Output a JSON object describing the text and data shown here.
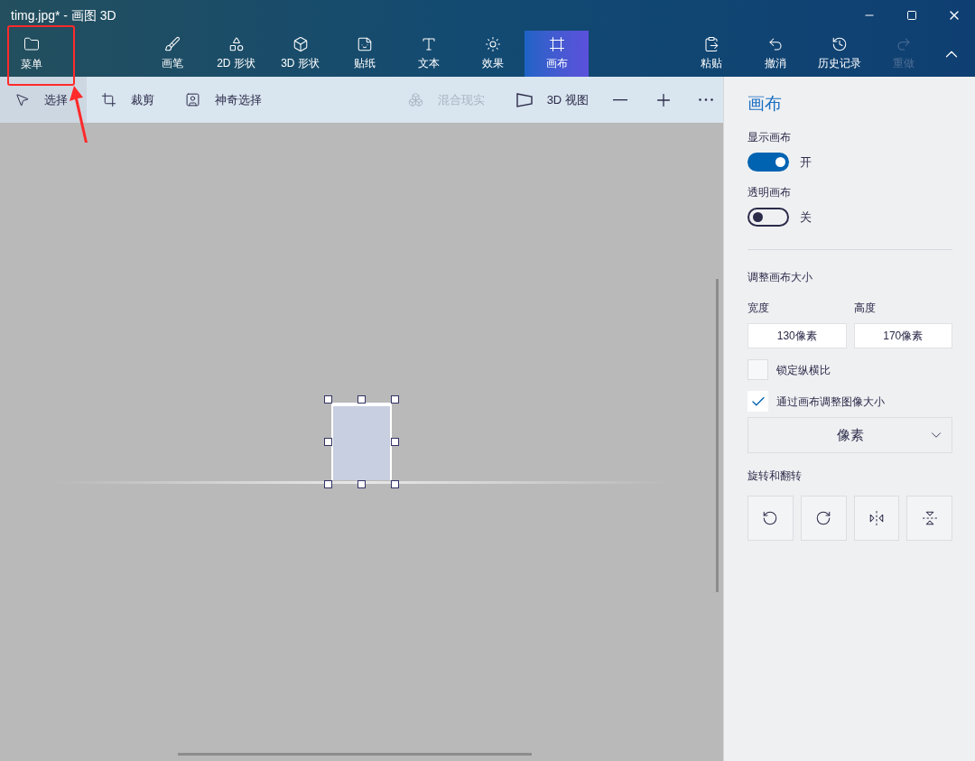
{
  "window": {
    "title": "timg.jpg* - 画图 3D"
  },
  "menu_button": {
    "label": "菜单"
  },
  "tools": [
    {
      "label": "画笔",
      "selected": false
    },
    {
      "label": "2D 形状",
      "selected": false
    },
    {
      "label": "3D 形状",
      "selected": false
    },
    {
      "label": "贴纸",
      "selected": false
    },
    {
      "label": "文本",
      "selected": false
    },
    {
      "label": "效果",
      "selected": false
    },
    {
      "label": "画布",
      "selected": true
    }
  ],
  "actions": [
    {
      "label": "粘贴",
      "disabled": false
    },
    {
      "label": "撤消",
      "disabled": false
    },
    {
      "label": "历史记录",
      "disabled": false
    },
    {
      "label": "重做",
      "disabled": true
    }
  ],
  "toolbar": [
    {
      "label": "选择",
      "selected": true,
      "disabled": false
    },
    {
      "label": "裁剪",
      "selected": false,
      "disabled": false
    },
    {
      "label": "神奇选择",
      "selected": false,
      "disabled": false
    },
    {
      "label": "混合现实",
      "selected": false,
      "disabled": true
    },
    {
      "label": "3D 视图",
      "selected": false,
      "disabled": false
    }
  ],
  "panel": {
    "title": "画布",
    "toggles": [
      {
        "label": "显示画布",
        "on": true,
        "state_text": "开"
      },
      {
        "label": "透明画布",
        "on": false,
        "state_text": "关"
      }
    ],
    "resize_heading": "调整画布大小",
    "fields": [
      {
        "label": "宽度",
        "value": "130像素"
      },
      {
        "label": "高度",
        "value": "170像素"
      }
    ],
    "checkboxes": [
      {
        "label": "锁定纵横比",
        "checked": false
      },
      {
        "label": "通过画布调整图像大小",
        "checked": true
      }
    ],
    "unit_dropdown": {
      "value": "像素"
    },
    "rotate_heading": "旋转和翻转"
  }
}
